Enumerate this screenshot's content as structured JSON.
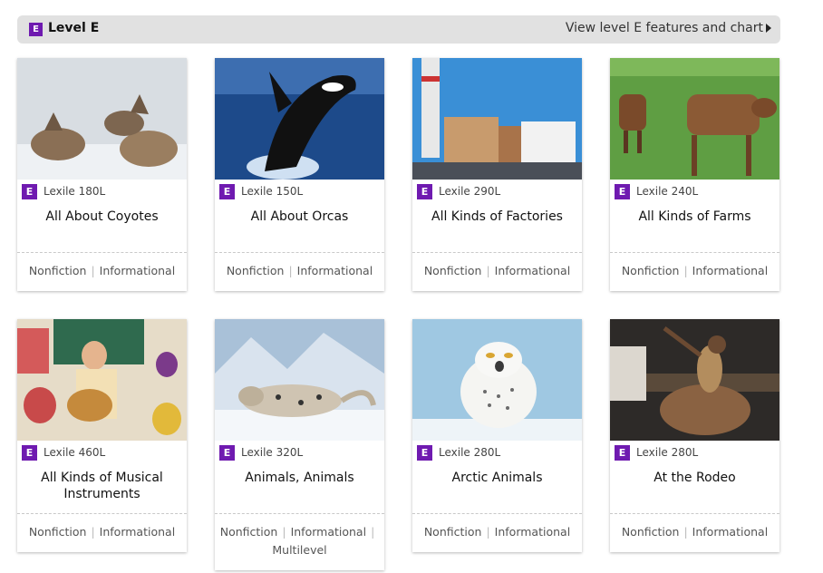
{
  "level": {
    "badge": "E",
    "title": "Level E",
    "view_link": "View level E features and chart"
  },
  "books": [
    {
      "badge": "E",
      "lexile": "Lexile 180L",
      "title": "All About Coyotes",
      "tags": [
        "Nonfiction",
        "Informational"
      ]
    },
    {
      "badge": "E",
      "lexile": "Lexile 150L",
      "title": "All About Orcas",
      "tags": [
        "Nonfiction",
        "Informational"
      ]
    },
    {
      "badge": "E",
      "lexile": "Lexile 290L",
      "title": "All Kinds of Factories",
      "tags": [
        "Nonfiction",
        "Informational"
      ]
    },
    {
      "badge": "E",
      "lexile": "Lexile 240L",
      "title": "All Kinds of Farms",
      "tags": [
        "Nonfiction",
        "Informational"
      ]
    },
    {
      "badge": "E",
      "lexile": "Lexile 460L",
      "title": "All Kinds of Musical Instruments",
      "tags": [
        "Nonfiction",
        "Informational"
      ]
    },
    {
      "badge": "E",
      "lexile": "Lexile 320L",
      "title": "Animals, Animals",
      "tags": [
        "Nonfiction",
        "Informational",
        "Multilevel"
      ]
    },
    {
      "badge": "E",
      "lexile": "Lexile 280L",
      "title": "Arctic Animals",
      "tags": [
        "Nonfiction",
        "Informational"
      ]
    },
    {
      "badge": "E",
      "lexile": "Lexile 280L",
      "title": "At the Rodeo",
      "tags": [
        "Nonfiction",
        "Informational"
      ]
    }
  ],
  "colors": {
    "badge": "#6f1ab0",
    "header_bg": "#e1e1e1"
  }
}
